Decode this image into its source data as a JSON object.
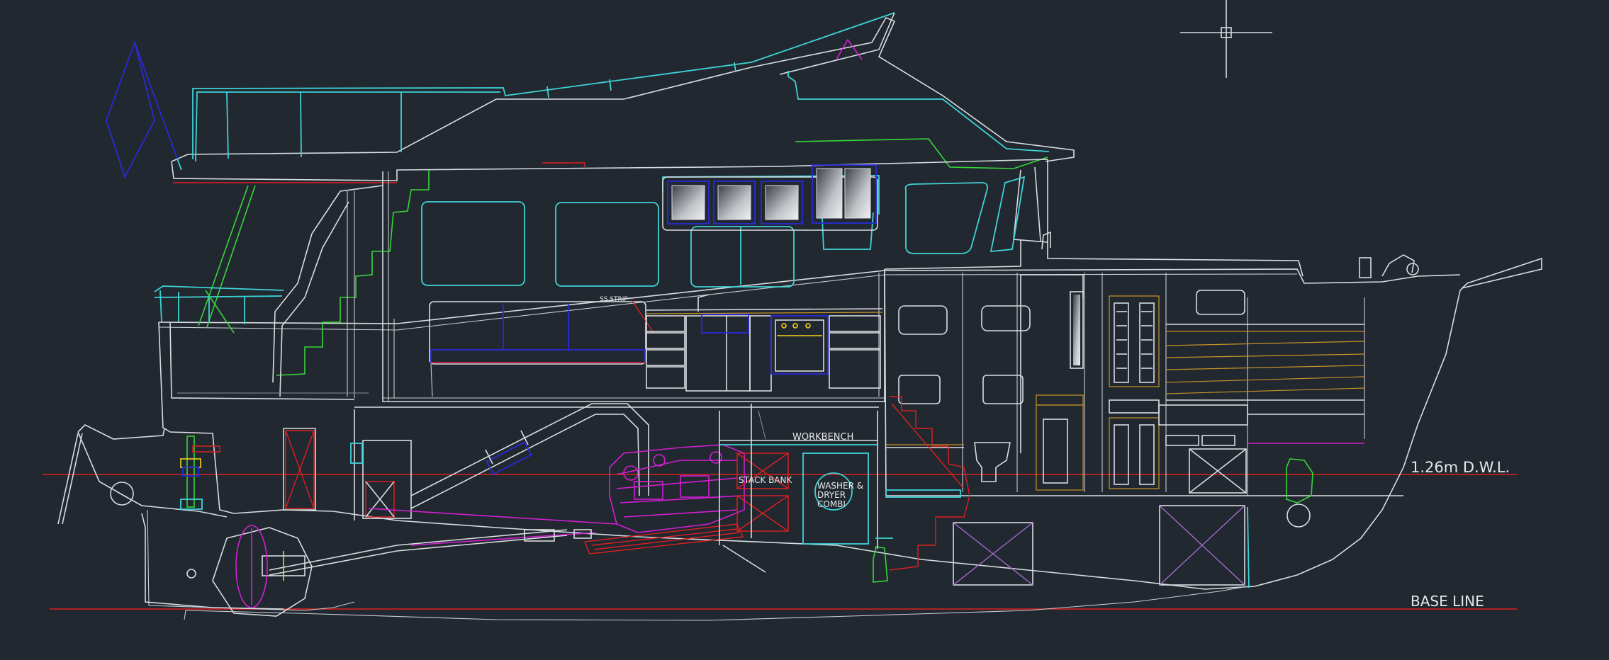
{
  "labels": {
    "dwl": "1.26m  D.W.L.",
    "baseline": "BASE  LINE",
    "workbench": "WORKBENCH",
    "stack_bank": "STACK BANK",
    "washer_1": "WASHER &",
    "washer_2": "DRYER",
    "washer_3": "COMBI",
    "ss_strip": "SS STRIP"
  },
  "colors": {
    "background": "#212830",
    "outline": "#d9dde2",
    "cyan": "#3fd2d6",
    "green": "#38d63a",
    "red": "#e01f1f",
    "blue": "#2a2ad8",
    "magenta": "#d21fd2",
    "yellow": "#f2d21a"
  },
  "icons": [
    "cad-crosshair-cursor"
  ]
}
